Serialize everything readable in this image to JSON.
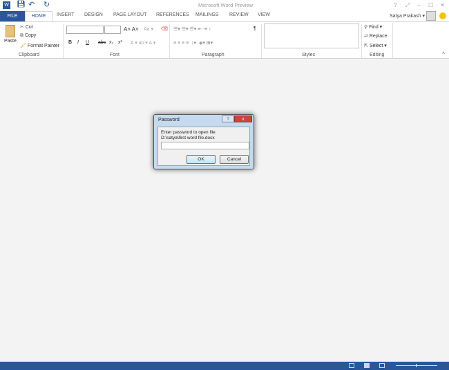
{
  "window": {
    "title": "Microsoft Word Preview",
    "help": "?",
    "restore": "⤢",
    "minimize": "–",
    "maximize": "☐",
    "close": "✕"
  },
  "user": {
    "name": "Satya Prakash ▾"
  },
  "tabs": [
    "FILE",
    "HOME",
    "INSERT",
    "DESIGN",
    "PAGE LAYOUT",
    "REFERENCES",
    "MAILINGS",
    "REVIEW",
    "VIEW"
  ],
  "clipboard": {
    "paste": "Paste",
    "cut": "Cut",
    "copy": "Copy",
    "format_painter": "Format Painter",
    "label": "Clipboard"
  },
  "font": {
    "label": "Font",
    "bold": "B",
    "italic": "I",
    "underline": "U",
    "strike": "abc",
    "sub": "x₂",
    "sup": "x²"
  },
  "paragraph": {
    "label": "Paragraph",
    "show": "¶"
  },
  "styles": {
    "label": "Styles"
  },
  "editing": {
    "find": "Find ▾",
    "replace": "Replace",
    "select": "Select ▾",
    "label": "Editing"
  },
  "dialog": {
    "title": "Password",
    "prompt": "Enter password to open file",
    "path": "D:\\satya\\first word file.docx",
    "value": "",
    "ok": "OK",
    "cancel": "Cancel",
    "help": "?",
    "close": "x"
  }
}
